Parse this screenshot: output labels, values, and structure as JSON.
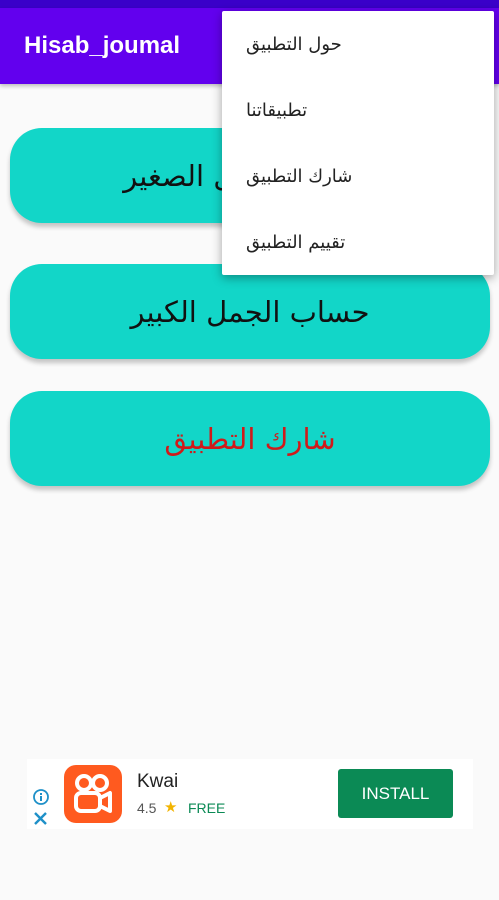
{
  "app": {
    "title": "Hisab_joumal"
  },
  "buttons": {
    "small": "حساب الجمل الصغير",
    "big": "حساب الجمل الكبير",
    "share": "شارك التطبيق"
  },
  "menu": {
    "items": [
      "حول التطبيق",
      "تطبيقاتنا",
      "شارك التطبيق",
      "تقييم التطبيق"
    ]
  },
  "ad": {
    "app_name": "Kwai",
    "rating": "4.5",
    "price": "FREE",
    "install": "INSTALL",
    "colors": {
      "install": "#0b8a55",
      "logo": "#ff5a1f",
      "star": "#f2b400"
    },
    "icons": [
      "info-icon",
      "close-icon",
      "star-icon",
      "kwai-logo"
    ]
  },
  "colors": {
    "appbar": "#6200ee",
    "button": "#12d6c8",
    "share_text": "#d01a1a"
  }
}
